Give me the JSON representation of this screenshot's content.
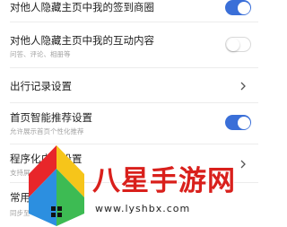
{
  "settings": [
    {
      "title": "对他人隐藏主页中我的签到商圈",
      "subtitle": "",
      "control": "toggle",
      "on": true
    },
    {
      "title": "对他人隐藏主页中我的互动内容",
      "subtitle": "问答、评论、相册等",
      "control": "toggle",
      "on": false
    },
    {
      "title": "出行记录设置",
      "subtitle": "",
      "control": "chevron"
    },
    {
      "title": "首页智能推荐设置",
      "subtitle": "允许展示首页个性化推荐",
      "control": "toggle",
      "on": true
    },
    {
      "title": "程序化广告设置",
      "subtitle": "支持屏",
      "control": "chevron"
    },
    {
      "title": "常用",
      "subtitle": "同步至",
      "control": "none"
    }
  ],
  "watermark": {
    "text": "八星手游网",
    "url": "www.lyshbx.com"
  },
  "colors": {
    "toggle_on": "#3a6fd8",
    "watermark_main": "#d9201c"
  }
}
